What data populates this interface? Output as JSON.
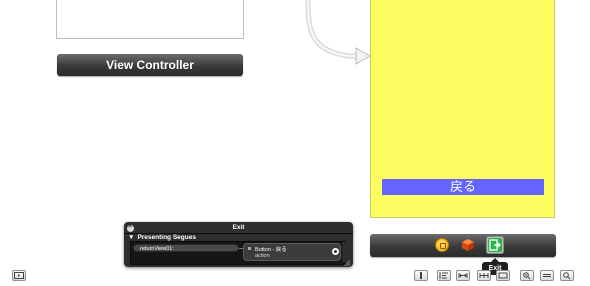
{
  "canvas": {
    "left_controller_title": "View Controller",
    "button_label": "戻る"
  },
  "dock": {
    "icons": [
      "first-responder-icon",
      "cube-icon",
      "exit-icon"
    ],
    "tooltip": "Exit"
  },
  "hud": {
    "title": "Exit",
    "section_title": "Presenting Segues",
    "unwind_action": "returnView01:",
    "target_label": "Button - 戻る",
    "target_action": "action"
  },
  "toolbar": {
    "left_icons": [
      "sidebar-toggle-icon"
    ],
    "right_icons": [
      "align-icon",
      "pin-icon",
      "resolve-icon",
      "resize-icon",
      "zoom-out-icon",
      "zoom-actual-icon",
      "zoom-in-icon"
    ]
  },
  "colors": {
    "yellow_view": "#fdfd62",
    "button_bg": "#6464ff",
    "exit_green": "#2db34a"
  }
}
